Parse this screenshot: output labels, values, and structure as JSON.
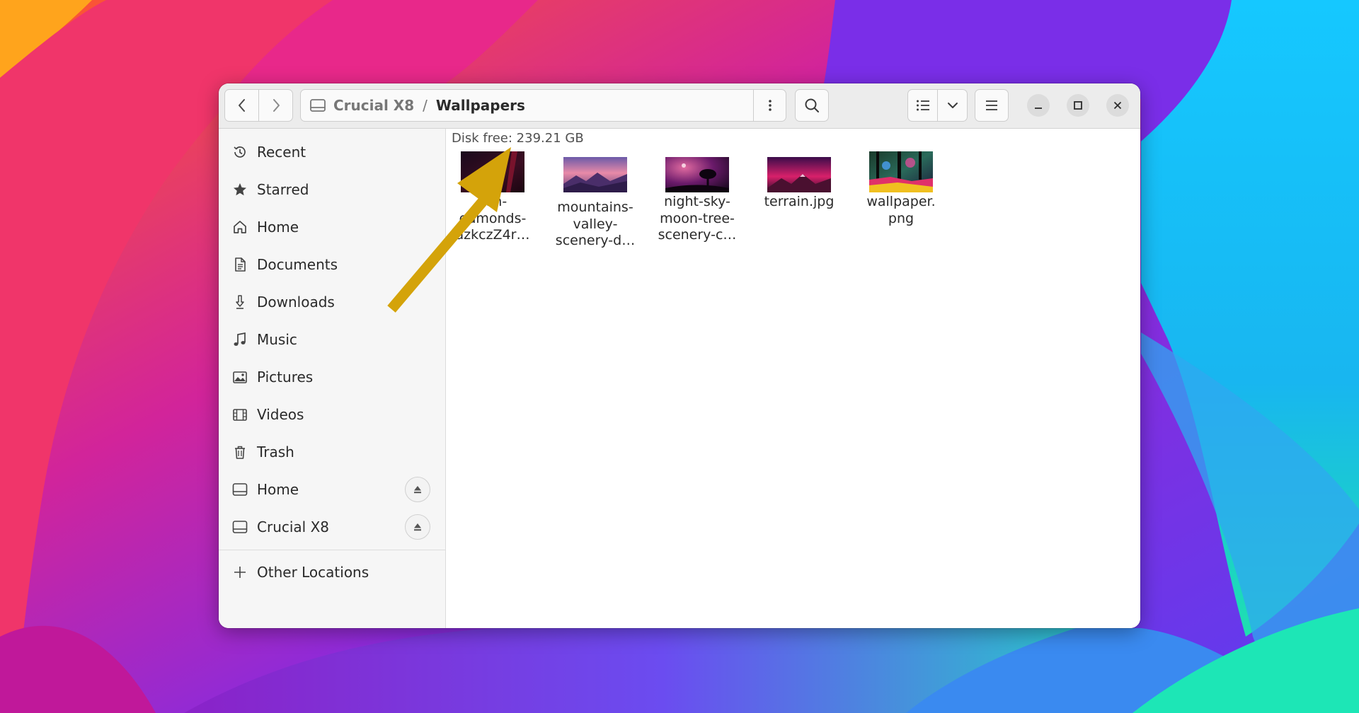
{
  "window": {
    "breadcrumb": {
      "drive": "Crucial X8",
      "separator": "/",
      "current": "Wallpapers"
    }
  },
  "sidebar": {
    "places": [
      {
        "label": "Recent",
        "icon": "clock-icon"
      },
      {
        "label": "Starred",
        "icon": "star-icon"
      },
      {
        "label": "Home",
        "icon": "home-icon"
      },
      {
        "label": "Documents",
        "icon": "document-icon"
      },
      {
        "label": "Downloads",
        "icon": "download-icon"
      },
      {
        "label": "Music",
        "icon": "music-note-icon"
      },
      {
        "label": "Pictures",
        "icon": "picture-icon"
      },
      {
        "label": "Videos",
        "icon": "film-icon"
      },
      {
        "label": "Trash",
        "icon": "trash-icon"
      }
    ],
    "devices": [
      {
        "label": "Home",
        "icon": "drive-icon",
        "eject": true
      },
      {
        "label": "Crucial X8",
        "icon": "drive-icon",
        "eject": true
      }
    ],
    "other": {
      "label": "Other Locations",
      "icon": "plus-icon"
    }
  },
  "content": {
    "disk_free": "Disk free: 239.21 GB",
    "files": [
      {
        "lines": [
          "ash-",
          "edmonds-",
          "azkczZ4r…"
        ],
        "thumb": "dark-red-abstract"
      },
      {
        "lines": [
          "mountains-",
          "valley-",
          "scenery-d…"
        ],
        "thumb": "pink-mountain-sunset"
      },
      {
        "lines": [
          "night-sky-",
          "moon-tree-",
          "scenery-c…"
        ],
        "thumb": "purple-night-tree"
      },
      {
        "lines": [
          "terrain.jpg"
        ],
        "thumb": "red-mountain-terrain"
      },
      {
        "lines": [
          "wallpaper.",
          "png"
        ],
        "thumb": "colorful-forest"
      }
    ]
  },
  "annotation": {
    "arrow_color": "#d4a30a"
  },
  "theme": {
    "accent": "#e95420",
    "window_bg": "#ffffff",
    "sidebar_bg": "#f6f6f6"
  }
}
